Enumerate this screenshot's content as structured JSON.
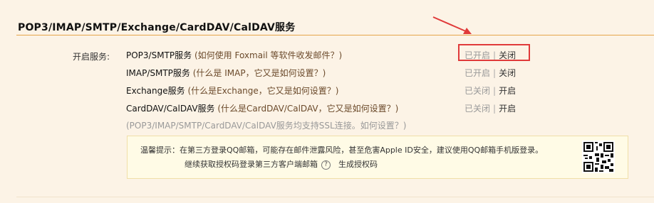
{
  "section": {
    "title": "POP3/IMAP/SMTP/Exchange/CardDAV/CalDAV服务"
  },
  "open_services_label": "开启服务:",
  "services": [
    {
      "name": "POP3/SMTP服务",
      "help": "(如何使用 Foxmail 等软件收发邮件？)",
      "state": "已开启",
      "action": "关闭"
    },
    {
      "name": "IMAP/SMTP服务",
      "help": "(什么是 IMAP，它又是如何设置？)",
      "state": "已开启",
      "action": "关闭"
    },
    {
      "name": "Exchange服务",
      "help": "(什么是Exchange，它又是如何设置？)",
      "state": "已关闭",
      "action": "开启"
    },
    {
      "name": "CardDAV/CalDAV服务",
      "help": "(什么是CardDAV/CalDAV，它又是如何设置？)",
      "state": "已关闭",
      "action": "开启"
    }
  ],
  "separator": "|",
  "ssl_note": "(POP3/IMAP/SMTP/CardDAV/CalDAV服务均支持SSL连接。如何设置？)",
  "tip": {
    "line1": "温馨提示：在第三方登录QQ邮箱，可能存在邮件泄露风险，甚至危害Apple ID安全，建议使用QQ邮箱手机版登录。",
    "line2": "继续获取授权码登录第三方客户端邮箱",
    "help_glyph": "?",
    "generate_link": "生成授权码"
  },
  "colors": {
    "highlight": "#e03a3a",
    "rule": "#e5a44a",
    "background": "#fcf3e6"
  }
}
